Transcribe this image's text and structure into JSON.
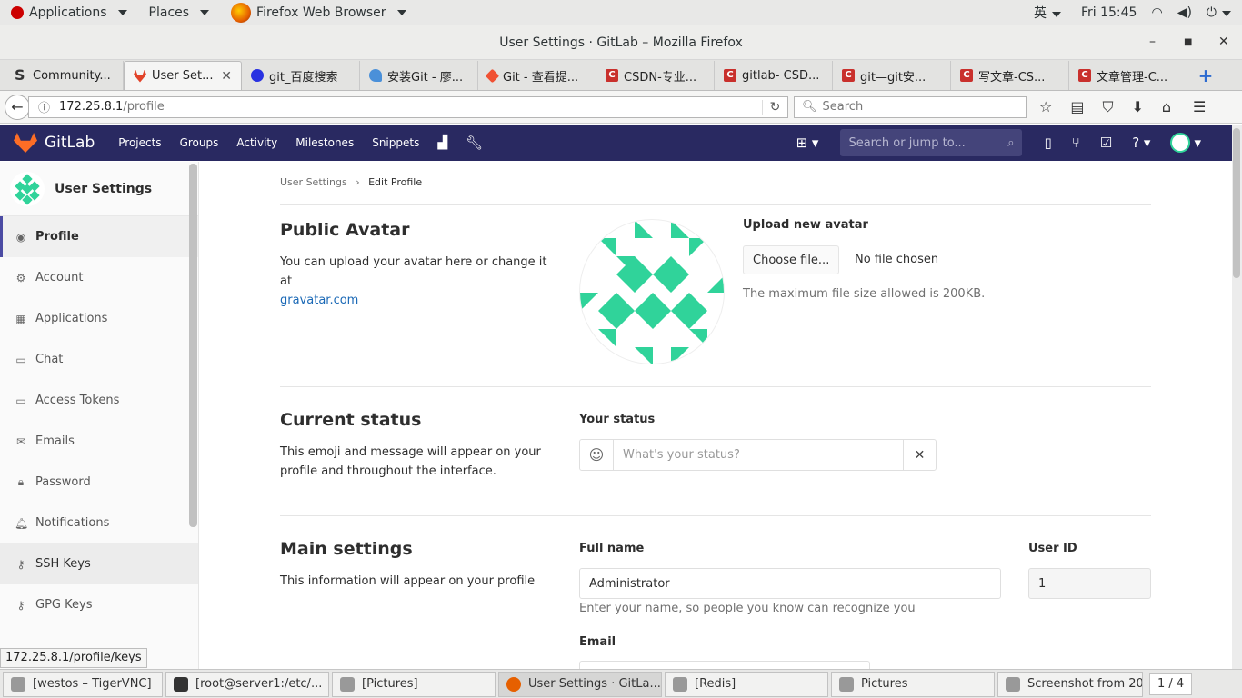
{
  "system_bar": {
    "applications": "Applications",
    "places": "Places",
    "firefox": "Firefox Web Browser",
    "ime": "英",
    "clock": "Fri 15:45"
  },
  "window": {
    "title": "User Settings · GitLab – Mozilla Firefox"
  },
  "tabs": [
    {
      "label": "Community...",
      "icon": "s-icon"
    },
    {
      "label": "User Set...",
      "icon": "gitlab-icon"
    },
    {
      "label": "git_百度搜索",
      "icon": "baidu-icon"
    },
    {
      "label": "安装Git - 廖...",
      "icon": "rocket-icon"
    },
    {
      "label": "Git - 查看提...",
      "icon": "git-icon"
    },
    {
      "label": "CSDN-专业...",
      "icon": "csdn-icon"
    },
    {
      "label": "gitlab- CSD...",
      "icon": "csdn-icon"
    },
    {
      "label": "git—git安...",
      "icon": "csdn-icon"
    },
    {
      "label": "写文章-CS...",
      "icon": "csdn-icon"
    },
    {
      "label": "文章管理-C...",
      "icon": "csdn-icon"
    }
  ],
  "urlbar": {
    "host": "172.25.8.1",
    "path": "/profile",
    "search_placeholder": "Search"
  },
  "gitlab_header": {
    "brand": "GitLab",
    "nav": [
      "Projects",
      "Groups",
      "Activity",
      "Milestones",
      "Snippets"
    ],
    "search_placeholder": "Search or jump to..."
  },
  "sidebar": {
    "title": "User Settings",
    "items": [
      {
        "label": "Profile",
        "icon": "user-icon"
      },
      {
        "label": "Account",
        "icon": "account-icon"
      },
      {
        "label": "Applications",
        "icon": "grid-icon"
      },
      {
        "label": "Chat",
        "icon": "chat-icon"
      },
      {
        "label": "Access Tokens",
        "icon": "token-icon"
      },
      {
        "label": "Emails",
        "icon": "envelope-icon"
      },
      {
        "label": "Password",
        "icon": "lock-icon"
      },
      {
        "label": "Notifications",
        "icon": "bell-icon"
      },
      {
        "label": "SSH Keys",
        "icon": "key-icon"
      },
      {
        "label": "GPG Keys",
        "icon": "key-icon"
      }
    ]
  },
  "breadcrumb": {
    "parent": "User Settings",
    "current": "Edit Profile"
  },
  "avatar_section": {
    "title": "Public Avatar",
    "desc": "You can upload your avatar here or change it at",
    "link": "gravatar.com",
    "upload_label": "Upload new avatar",
    "choose_button": "Choose file...",
    "no_file": "No file chosen",
    "max_size": "The maximum file size allowed is 200KB."
  },
  "status_section": {
    "title": "Current status",
    "desc": "This emoji and message will appear on your profile and throughout the interface.",
    "label": "Your status",
    "placeholder": "What's your status?"
  },
  "main_settings": {
    "title": "Main settings",
    "desc": "This information will appear on your profile",
    "full_name_label": "Full name",
    "full_name_value": "Administrator",
    "full_name_hint": "Enter your name, so people you know can recognize you",
    "user_id_label": "User ID",
    "user_id_value": "1",
    "email_label": "Email"
  },
  "link_status": "172.25.8.1/profile/keys",
  "taskbar": [
    {
      "label": "[westos – TigerVNC]",
      "active": false
    },
    {
      "label": "[root@server1:/etc/...",
      "active": false
    },
    {
      "label": "[Pictures]",
      "active": false
    },
    {
      "label": "User Settings · GitLa...",
      "active": true
    },
    {
      "label": "[Redis]",
      "active": false
    },
    {
      "label": "Pictures",
      "active": false
    },
    {
      "label": "Screenshot from 20...",
      "active": false
    }
  ],
  "pager": "1 / 4"
}
